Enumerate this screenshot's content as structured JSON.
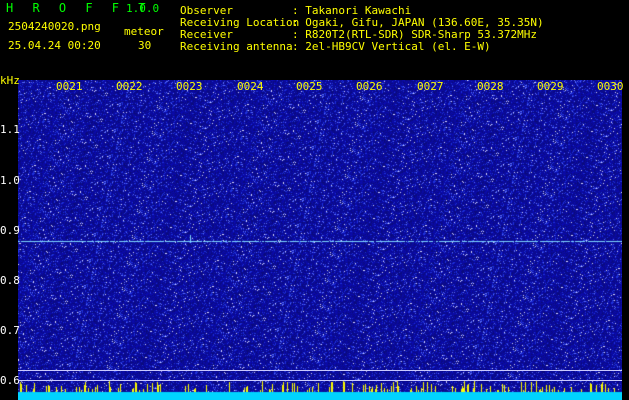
{
  "header": {
    "app_name": "H R O F F T",
    "version": "1.0.0",
    "filename": "2504240020.png",
    "datetime": "25.04.24 00:20",
    "meteor_label": "meteor",
    "meteor_count": "30"
  },
  "info": {
    "observer_label": "Observer",
    "observer_value": ": Takanori Kawachi",
    "location_label": "Receiving Location",
    "location_value": ": Ogaki, Gifu, JAPAN (136.60E, 35.35N)",
    "receiver_label": "Receiver",
    "receiver_value": ": R820T2(RTL-SDR) SDR-Sharp 53.372MHz",
    "antenna_label": "Receiving antenna",
    "antenna_value": ": 2el-HB9CV Vertical (el. E-W)"
  },
  "axis": {
    "unit": "kHz",
    "y_ticks": [
      "1.1",
      "1.0",
      "0.9",
      "0.8",
      "0.7",
      "0.6"
    ],
    "x_ticks": [
      "0021",
      "0022",
      "0023",
      "0024",
      "0025",
      "0026",
      "0027",
      "0028",
      "0029",
      "0030"
    ]
  },
  "colors": {
    "background": "#000000",
    "noise_base": "#1a1ab4",
    "carrier_line": "#7fd6ff",
    "reference_line": "#c8c8ff",
    "label_yellow": "#ffff00",
    "title_green": "#00ff00",
    "bottom_band": "#00d4ff"
  }
}
